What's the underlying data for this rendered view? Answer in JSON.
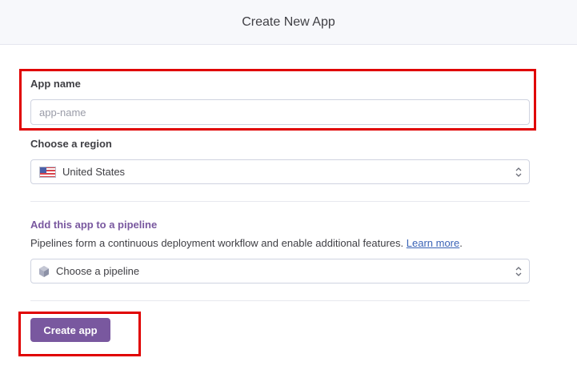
{
  "header": {
    "title": "Create New App"
  },
  "app_name": {
    "label": "App name",
    "placeholder": "app-name",
    "value": ""
  },
  "region": {
    "label": "Choose a region",
    "selected": "United States",
    "flag_icon": "us-flag-icon"
  },
  "pipeline": {
    "title": "Add this app to a pipeline",
    "description": "Pipelines form a continuous deployment workflow and enable additional features.",
    "link_text": "Learn more",
    "trailing": ".",
    "select_placeholder": "Choose a pipeline",
    "icon": "hexagon-icon"
  },
  "actions": {
    "create_label": "Create app"
  },
  "colors": {
    "accent": "#79589f",
    "highlight": "#e00000",
    "link": "#3a63b6"
  }
}
